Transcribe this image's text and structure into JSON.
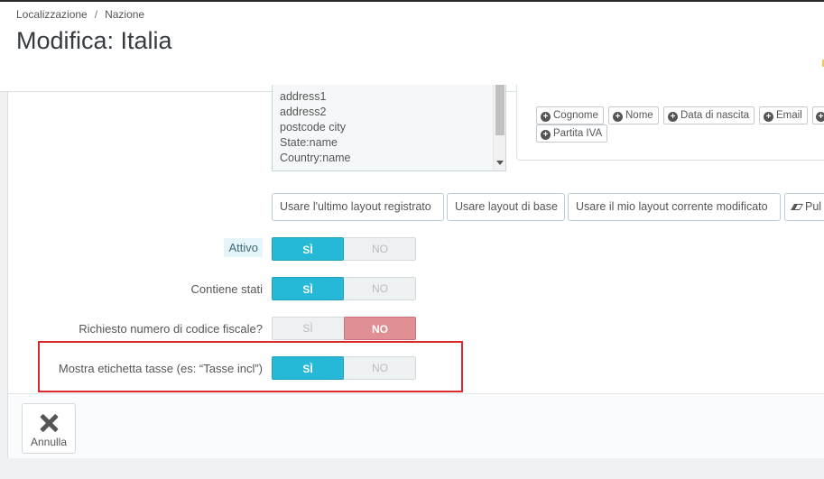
{
  "header": {
    "breadcrumb": [
      "Localizzazione",
      "Nazione"
    ],
    "breadcrumb_separator": "/",
    "title": "Modifica: Italia"
  },
  "address_layout": {
    "lines": [
      "address1",
      "address2",
      "postcode city",
      "State:name",
      "Country:name"
    ]
  },
  "field_buttons": [
    "Cognome",
    "Nome",
    "Data di nascita",
    "Email",
    "Partita IVA"
  ],
  "layout_buttons": {
    "last": "Usare l'ultimo layout registrato",
    "base": "Usare layout di base",
    "current": "Usare il mio layout corrente modificato",
    "clear": "Pul"
  },
  "form": {
    "active": {
      "label": "Attivo",
      "yes": "SÌ",
      "no": "NO",
      "value": "SÌ"
    },
    "contains_states": {
      "label": "Contiene stati",
      "yes": "SÌ",
      "no": "NO",
      "value": "SÌ"
    },
    "need_identification": {
      "label": "Richiesto numero di codice fiscale?",
      "yes": "SÌ",
      "no": "NO",
      "value": "NO"
    },
    "display_tax_label": {
      "label": "Mostra etichetta tasse (es: “Tasse incl”)",
      "yes": "SÌ",
      "no": "NO",
      "value": "SÌ"
    }
  },
  "footer": {
    "cancel": "Annulla"
  },
  "colors": {
    "accent": "#25b9d7",
    "danger": "#e08f95",
    "highlight_border": "#d92a2a"
  }
}
